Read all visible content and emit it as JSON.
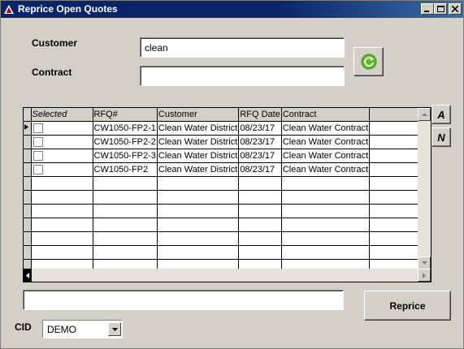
{
  "window": {
    "title": "Reprice Open Quotes"
  },
  "form": {
    "customer_label": "Customer",
    "customer_value": "clean",
    "contract_label": "Contract",
    "contract_value": "",
    "status_value": "",
    "reprice_label": "Reprice",
    "cid_label": "CID",
    "cid_value": "DEMO"
  },
  "side_buttons": {
    "a_label": "A",
    "n_label": "N"
  },
  "grid": {
    "headers": [
      "Selected",
      "RFQ#",
      "Customer",
      "RFQ Date",
      "Contract"
    ],
    "rows": [
      {
        "rfq": "CW1050-FP2-1",
        "customer": "Clean Water District",
        "date": "08/23/17",
        "contract": "Clean Water Contract"
      },
      {
        "rfq": "CW1050-FP2-2",
        "customer": "Clean Water District",
        "date": "08/23/17",
        "contract": "Clean Water Contract"
      },
      {
        "rfq": "CW1050-FP2-3",
        "customer": "Clean Water District",
        "date": "08/23/17",
        "contract": "Clean Water Contract"
      },
      {
        "rfq": "CW1050-FP2",
        "customer": "Clean Water District",
        "date": "08/23/17",
        "contract": "Clean Water Contract"
      }
    ]
  },
  "icons": [
    "app-icon",
    "minimize-icon",
    "maximize-icon",
    "close-icon",
    "refresh-icon",
    "scroll-up-icon",
    "scroll-down-icon",
    "scroll-left-icon",
    "scroll-right-icon",
    "dropdown-arrow-icon",
    "row-pointer-icon"
  ],
  "colors": {
    "title_bar": "#0a246a",
    "selected_header": "#e00000",
    "refresh_green": "#5cb82e"
  }
}
